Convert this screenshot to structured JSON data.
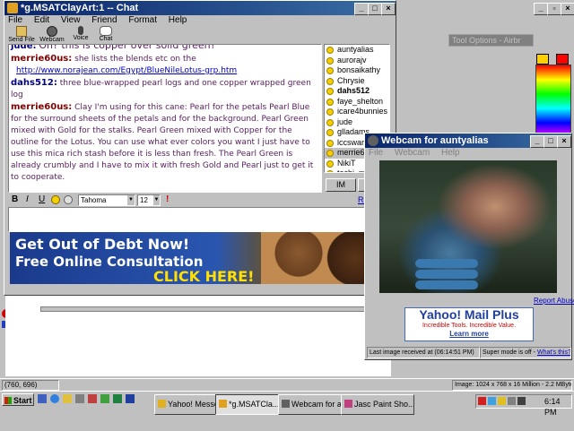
{
  "desktop": {
    "bg_color": "#c0c0c0"
  },
  "right_panel": {
    "tool_options_title": "Tool Options - Airbr"
  },
  "chat_window": {
    "title": "*g.MSATClayArt:1 -- Chat",
    "menu": [
      "File",
      "Edit",
      "View",
      "Friend",
      "Format",
      "Help"
    ],
    "toolbar": [
      {
        "label": "Send File",
        "icon": "send-file-icon"
      },
      {
        "label": "Webcam",
        "icon": "webcam-icon"
      },
      {
        "label": "Voice",
        "icon": "voice-icon"
      },
      {
        "label": "Chat",
        "icon": "chat-icon"
      }
    ],
    "messages": [
      {
        "user": "jude:",
        "user_color": "#000080",
        "text": "Oh? this is copper over solid green?",
        "text_color": "#5a2060"
      },
      {
        "user": "merrie60us:",
        "user_color": "#800000",
        "text": "she lists the blends etc on the",
        "text_color": "#5a2060"
      },
      {
        "user": "",
        "user_color": "#000080",
        "text": "http://www.norajean.com/Egypt/BlueNileLotus-grp.htm",
        "text_color": "#0000c0",
        "link": true
      },
      {
        "user": "dahs512:",
        "user_color": "#000080",
        "text": "three blue-wrapped pearl logs and one copper wrapped green log",
        "text_color": "#5a2060"
      },
      {
        "user": "merrie60us:",
        "user_color": "#800000",
        "text": "Clay I'm using for this cane: Pearl for the petals Pearl Blue for the surround sheets of the petals and for the background. Pearl Green mixed with Gold for the stalks. Pearl Green mixed with Copper for the outline for the Lotus. You can use what ever colors you want I just have to use this mica rich stash before it is less than fresh. The Pearl Green is already crumbly and I have to mix it with fresh Gold and Pearl just to get it to cooperate.",
        "text_color": "#5a2060"
      }
    ],
    "users": [
      "auntyalias",
      "aurorajv",
      "bonsaikathy",
      "Chrysie",
      "dahs512",
      "faye_shelton",
      "icare4bunnies",
      "jude",
      "glladams",
      "lccswartz",
      "merrie60us",
      "NikiT",
      "techi_mom"
    ],
    "im_button": "IM",
    "ig_button": "Ig",
    "font_name": "Tahoma",
    "font_size": "12",
    "format_buttons": [
      "B",
      "I",
      "U"
    ],
    "ad": {
      "line1": "Get Out of Debt Now!",
      "line2": "Free Online Consultation",
      "cta": "CLICK HERE!"
    },
    "reply_label": "Re"
  },
  "webcam_window": {
    "title": "Webcam for auntyalias",
    "menu": [
      "File",
      "Webcam",
      "Help"
    ],
    "report_abuse": "Report Abuse",
    "ad": {
      "title": "Yahoo! Mail Plus",
      "tagline": "Incredible Tools. Incredible Value.",
      "link": "Learn more"
    },
    "status_left": "Last image received at (06:14:51 PM)",
    "status_right_label": "Super mode is off -",
    "status_right_link": "What's this?"
  },
  "status_bar": {
    "coords": "(760, 696)",
    "image_info": "Image:  1024 x 768 x 16 Million - 2.2 MBytes"
  },
  "taskbar": {
    "start": "Start",
    "items": [
      "Yahoo! Messen...",
      "*g.MSATCla...",
      "Webcam for au...",
      "Jasc Paint Sho..."
    ],
    "clock": "6:14 PM"
  }
}
